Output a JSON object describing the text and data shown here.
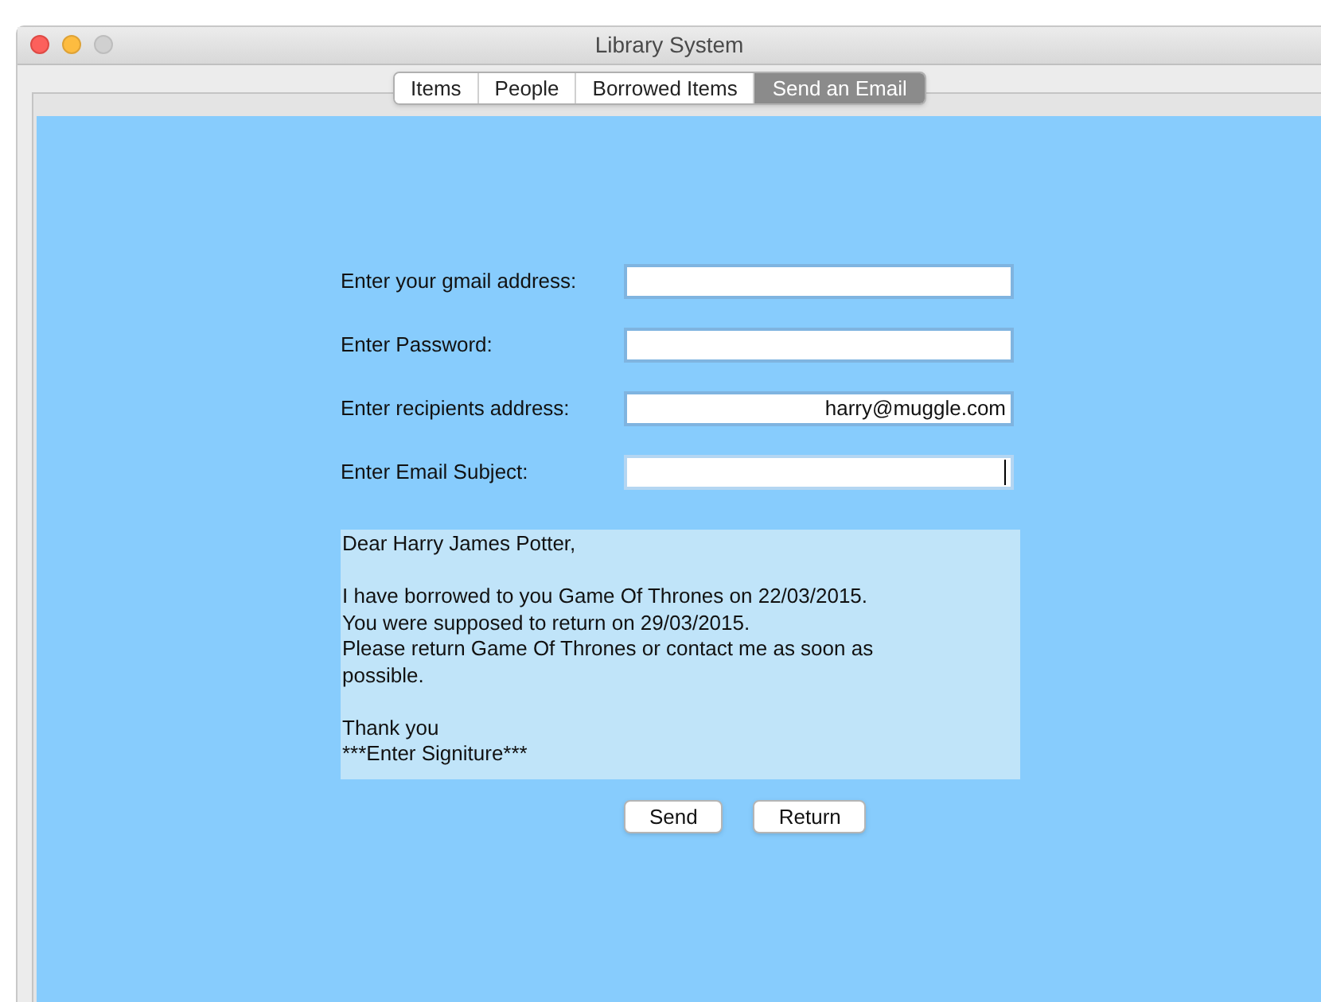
{
  "window": {
    "title": "Library System"
  },
  "tabs": [
    {
      "label": "Items",
      "selected": false
    },
    {
      "label": "People",
      "selected": false
    },
    {
      "label": "Borrowed Items",
      "selected": false
    },
    {
      "label": "Send an Email",
      "selected": true
    }
  ],
  "form": {
    "fields": [
      {
        "label": "Enter your gmail address:",
        "focused": false
      },
      {
        "label": "Enter Password:",
        "focused": false
      },
      {
        "label": "Enter recipients address:",
        "value": "harry@muggle.com",
        "focused": false
      },
      {
        "label": "Enter Email Subject:",
        "focused": true
      }
    ],
    "message": {
      "paragraphs": [
        [
          "Dear Harry James Potter,"
        ],
        [
          "I have borrowed to you Game Of Thrones on 22/03/2015.",
          "You were supposed to return on 29/03/2015.",
          "Please return Game Of Thrones or contact me as soon as",
          "possible."
        ],
        [
          "Thank you",
          "***Enter Signiture***"
        ]
      ]
    },
    "buttons": [
      "Send",
      "Return"
    ]
  }
}
